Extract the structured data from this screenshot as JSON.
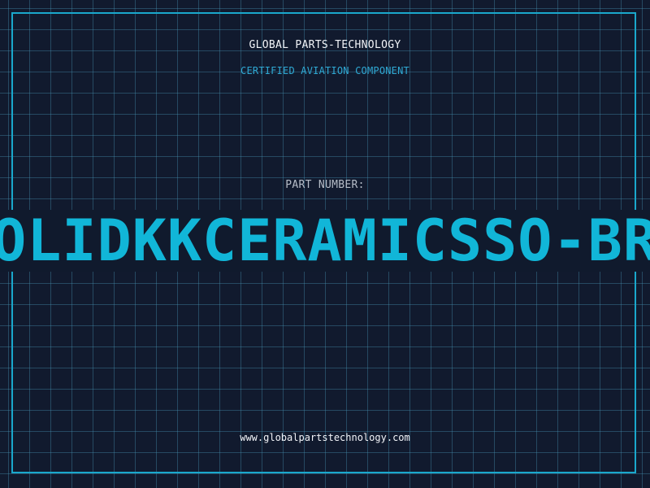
{
  "brand": {
    "name": "GLOBAL PARTS-TECHNOLOGY",
    "tagline": "CERTIFIED AVIATION COMPONENT"
  },
  "part": {
    "label": "PART NUMBER:",
    "number": "SOLIDKKCERAMICSSO-BRA"
  },
  "footer": {
    "website": "www.globalpartstechnology.com"
  },
  "colors": {
    "background": "#111a2e",
    "grid": "#2b6a86",
    "accent": "#11b6d8",
    "text": "#f2f4f8",
    "muted": "#b6bdc8"
  }
}
